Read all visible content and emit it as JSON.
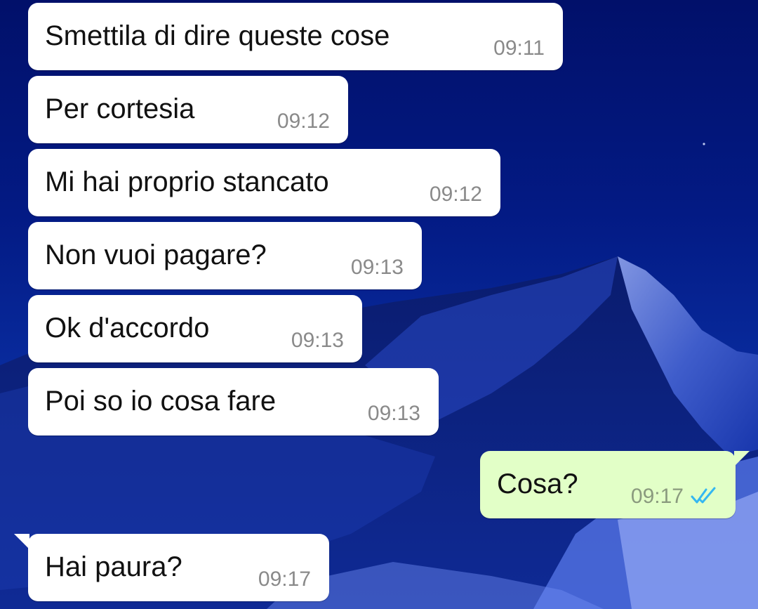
{
  "messages": [
    {
      "direction": "in",
      "text": "Smettila di dire queste cose",
      "time": "09:11"
    },
    {
      "direction": "in",
      "text": "Per cortesia",
      "time": "09:12"
    },
    {
      "direction": "in",
      "text": "Mi hai proprio stancato",
      "time": "09:12"
    },
    {
      "direction": "in",
      "text": "Non vuoi pagare?",
      "time": "09:13"
    },
    {
      "direction": "in",
      "text": "Ok d'accordo",
      "time": "09:13"
    },
    {
      "direction": "in",
      "text": "Poi so io cosa fare",
      "time": "09:13"
    },
    {
      "direction": "out",
      "text": "Cosa?",
      "time": "09:17",
      "status_icon": "double-check-read-icon"
    },
    {
      "direction": "in",
      "text": "Hai paura?",
      "time": "09:17"
    }
  ],
  "colors": {
    "incoming_bubble": "#ffffff",
    "outgoing_bubble": "#e2ffc7",
    "read_ticks": "#34b7f1",
    "wallpaper": "#031a84"
  },
  "wallpaper_icon": "night-mountain-wallpaper"
}
